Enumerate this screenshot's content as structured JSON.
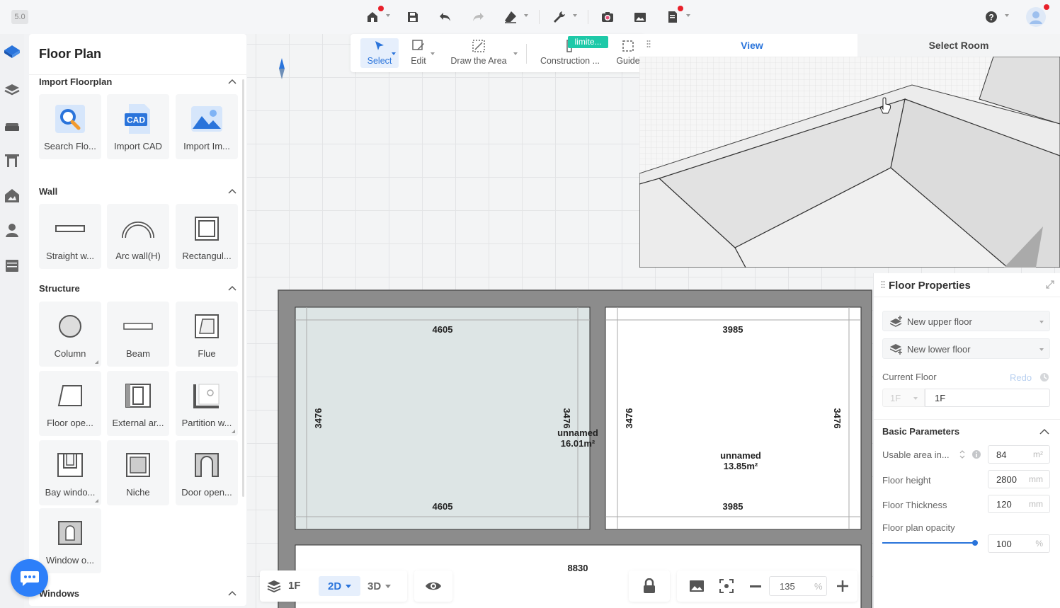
{
  "version": "5.0",
  "panel": {
    "title": "Floor Plan",
    "sections": [
      {
        "title": "Import Floorplan",
        "items": [
          "Search Flo...",
          "Import CAD",
          "Import Im..."
        ]
      },
      {
        "title": "Wall",
        "items": [
          "Straight w...",
          "Arc wall(H)",
          "Rectangul..."
        ]
      },
      {
        "title": "Structure",
        "items": [
          "Column",
          "Beam",
          "Flue",
          "Floor ope...",
          "External ar...",
          "Partition w...",
          "Bay windo...",
          "Niche",
          "Door open...",
          "Window o..."
        ]
      },
      {
        "title": "Windows",
        "items": []
      }
    ],
    "cad_icon_text": "CAD"
  },
  "tools": {
    "select": "Select",
    "edit": "Edit",
    "draw_area": "Draw the Area",
    "construction": "Construction ...",
    "guide": "Guide",
    "limited_badge": "limite..."
  },
  "view3d": {
    "tab_view": "View",
    "tab_select_room": "Select Room",
    "active_tab": "View"
  },
  "floorplan": {
    "rooms": [
      {
        "name": "unnamed",
        "area": "16.01m²",
        "width_top": "4605",
        "width_bottom": "4605",
        "height_left": "3476",
        "height_right": "3476"
      },
      {
        "name": "unnamed",
        "area": "13.85m²",
        "width_top": "3985",
        "width_bottom": "3985",
        "height_left": "3476",
        "height_right": "3476"
      }
    ],
    "overall_width": "8830"
  },
  "properties": {
    "title": "Floor Properties",
    "new_upper_floor": "New upper floor",
    "new_lower_floor": "New lower floor",
    "current_floor_label": "Current Floor",
    "redo": "Redo",
    "floor_select": "1F",
    "floor_name": "1F",
    "basic_parameters": "Basic Parameters",
    "usable_area_label": "Usable area in...",
    "usable_area_value": "84",
    "usable_area_unit": "m²",
    "floor_height_label": "Floor height",
    "floor_height_value": "2800",
    "floor_height_unit": "mm",
    "floor_thickness_label": "Floor Thickness",
    "floor_thickness_value": "120",
    "floor_thickness_unit": "mm",
    "opacity_label": "Floor plan opacity",
    "opacity_value": "100",
    "opacity_unit": "%",
    "opacity_fraction": 1.0
  },
  "bottombar": {
    "floor": "1F",
    "mode_2d": "2D",
    "mode_3d": "3D",
    "zoom": "135",
    "zoom_unit": "%"
  },
  "colors": {
    "accent": "#2a74db",
    "badge": "#1ec9a8",
    "notify": "#e8202a",
    "selected_room": "#dde5e5",
    "wall": "#8c8c8c"
  }
}
